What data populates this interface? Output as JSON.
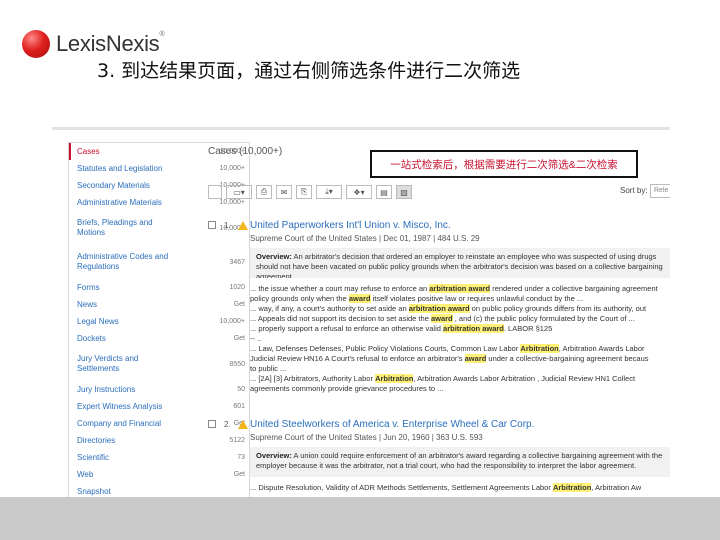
{
  "logo": {
    "text": "LexisNexis",
    "tm": "®"
  },
  "slide_title": "3. 到达结果页面，通过右侧筛选条件进行二次筛选",
  "sidebar": {
    "items": [
      {
        "label": "Cases",
        "count": "10,000+",
        "active": true
      },
      {
        "label": "Statutes and Legislation",
        "count": "10,000+"
      },
      {
        "label": "Secondary Materials",
        "count": "10,000+"
      },
      {
        "label": "Administrative Materials",
        "count": "10,000+"
      },
      {
        "label": "Briefs, Pleadings and Motions",
        "count": "10,000+"
      },
      {
        "label": "Administrative Codes and Regulations",
        "count": "3467"
      },
      {
        "label": "Forms",
        "count": "1020"
      },
      {
        "label": "News",
        "count": "Get"
      },
      {
        "label": "Legal News",
        "count": "10,000+"
      },
      {
        "label": "Dockets",
        "count": "Get"
      },
      {
        "label": "Jury Verdicts and Settlements",
        "count": "8550"
      },
      {
        "label": "Jury Instructions",
        "count": "50"
      },
      {
        "label": "Expert Witness Analysis",
        "count": "601"
      },
      {
        "label": "Company and Financial",
        "count": "Get"
      },
      {
        "label": "Directories",
        "count": "5122"
      },
      {
        "label": "Scientific",
        "count": "73"
      },
      {
        "label": "Web",
        "count": "Get"
      },
      {
        "label": "Snapshot",
        "count": ""
      }
    ]
  },
  "main": {
    "cases_title": "Cases (10,000+)",
    "annotation": "一站式检索后，根据需要进行二次筛选&二次检索",
    "sort_label": "Sort by:",
    "sort_value": "Rele"
  },
  "results": [
    {
      "num": "1.",
      "title": "United Paperworkers Int'l Union v. Misco, Inc.",
      "meta": "Supreme Court of the United States  |  Dec 01, 1987  |  484 U.S. 29",
      "overview_label": "Overview:",
      "overview": "An arbitrator's decision that ordered an employer to reinstate an employee who was suspected of using drugs should not have been vacated on public policy grounds when the arbitrator's decision was based on a collective bargaining agreement.",
      "snippets": [
        [
          "... the issue whether a court may refuse to enforce an ",
          "arbitration award",
          " rendered under a collective bargaining agreement"
        ],
        [
          "policy grounds only when the ",
          "award",
          " itself violates positive law or requires unlawful conduct by the ..."
        ],
        [
          "... way, if any, a court's authority to set aside an ",
          "arbitration award",
          " on public policy grounds differs from its authority, out"
        ],
        [
          "... Appeals did not support its decision to set aside the ",
          "award",
          " , and (c) the public policy formulated by the Court of ..."
        ],
        [
          "... properly support a refusal to enforce an otherwise valid ",
          "arbitration award",
          ". LABOR §125 "
        ],
        [
          "-- ..",
          "",
          ""
        ],
        [
          "... Law, Defenses Defenses, Public Policy Violations Courts, Common Law Labor ",
          "Arbitration",
          ", Arbitration Awards Labor"
        ],
        [
          "Judicial Review HN16 A Court's refusal to enforce an arbitrator's ",
          "award",
          " under a collective-bargaining agreement becaus"
        ],
        [
          "to public ...",
          "",
          ""
        ],
        [
          "... [2A] [3] Arbitrators, Authority Labor ",
          "Arbitration",
          ", Arbitration Awards Labor Arbitration , Judicial Review HN1 Collect"
        ],
        [
          "agreements commonly provide grievance procedures to ...",
          "",
          ""
        ]
      ]
    },
    {
      "num": "2.",
      "title": "United Steelworkers of America v. Enterprise Wheel & Car Corp.",
      "meta": "Supreme Court of the United States  |  Jun 20, 1960  |  363 U.S. 593",
      "overview_label": "Overview:",
      "overview": "A union could require enforcement of an arbitrator's award regarding a collective bargaining agreement with the employer because it was the arbitrator, not a trial court, who had the responsibility to interpret the labor agreement.",
      "snippets": [
        [
          "... Dispute Resolution, Validity of ADR Methods Settlements, Settlement Agreements Labor ",
          "Arbitration",
          ", Arbitration Aw"
        ]
      ]
    }
  ],
  "colors": {
    "link": "#2a6ebb",
    "active": "#c8102e",
    "highlight": "#fff176"
  }
}
